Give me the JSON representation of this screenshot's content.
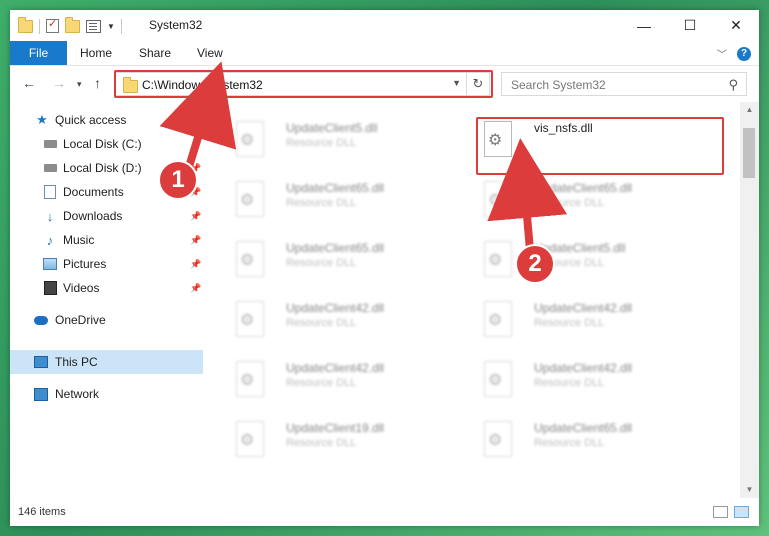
{
  "window": {
    "title": "System32",
    "controls": {
      "minimize": "—",
      "maximize": "☐",
      "close": "✕"
    }
  },
  "ribbon": {
    "tabs": [
      "File",
      "Home",
      "Share",
      "View"
    ],
    "help": "?"
  },
  "nav": {
    "back": "←",
    "forward": "→",
    "up": "↑",
    "address": "C:\\Windows\\System32",
    "refresh": "↻",
    "search_placeholder": "Search System32",
    "search_icon": "⚲"
  },
  "sidebar": {
    "items": [
      {
        "label": "Quick access",
        "icon": "star-icon"
      },
      {
        "label": "Local Disk (C:)",
        "icon": "disk-icon",
        "pinned": true
      },
      {
        "label": "Local Disk (D:)",
        "icon": "disk-icon",
        "pinned": true
      },
      {
        "label": "Documents",
        "icon": "document-icon",
        "pinned": true
      },
      {
        "label": "Downloads",
        "icon": "download-icon",
        "pinned": true
      },
      {
        "label": "Music",
        "icon": "music-icon",
        "pinned": true
      },
      {
        "label": "Pictures",
        "icon": "picture-icon",
        "pinned": true
      },
      {
        "label": "Videos",
        "icon": "video-icon",
        "pinned": true
      },
      {
        "label": "OneDrive",
        "icon": "cloud-icon"
      },
      {
        "label": "This PC",
        "icon": "computer-icon",
        "selected": true
      },
      {
        "label": "Network",
        "icon": "network-icon"
      }
    ]
  },
  "files": {
    "left_column": [
      {
        "name": "UpdateClient5.dll",
        "type": "Resource DLL"
      },
      {
        "name": "UpdateClient65.dll",
        "type": "Resource DLL"
      },
      {
        "name": "UpdateClient65.dll",
        "type": "Resource DLL"
      },
      {
        "name": "UpdateClient42.dll",
        "type": "Resource DLL"
      },
      {
        "name": "UpdateClient42.dll",
        "type": "Resource DLL"
      },
      {
        "name": "UpdateClient19.dll",
        "type": "Resource DLL"
      }
    ],
    "right_column": [
      {
        "name": "vis_nsfs.dll",
        "type": "",
        "highlighted": true
      },
      {
        "name": "UpdateClient65.dll",
        "type": "Resource DLL"
      },
      {
        "name": "UpdateClient5.dll",
        "type": "Resource DLL"
      },
      {
        "name": "UpdateClient42.dll",
        "type": "Resource DLL"
      },
      {
        "name": "UpdateClient42.dll",
        "type": "Resource DLL"
      },
      {
        "name": "UpdateClient65.dll",
        "type": "Resource DLL"
      }
    ]
  },
  "status": {
    "item_count": "146 items"
  },
  "annotations": {
    "step1": "1",
    "step2": "2",
    "color": "#dc3c3c"
  }
}
